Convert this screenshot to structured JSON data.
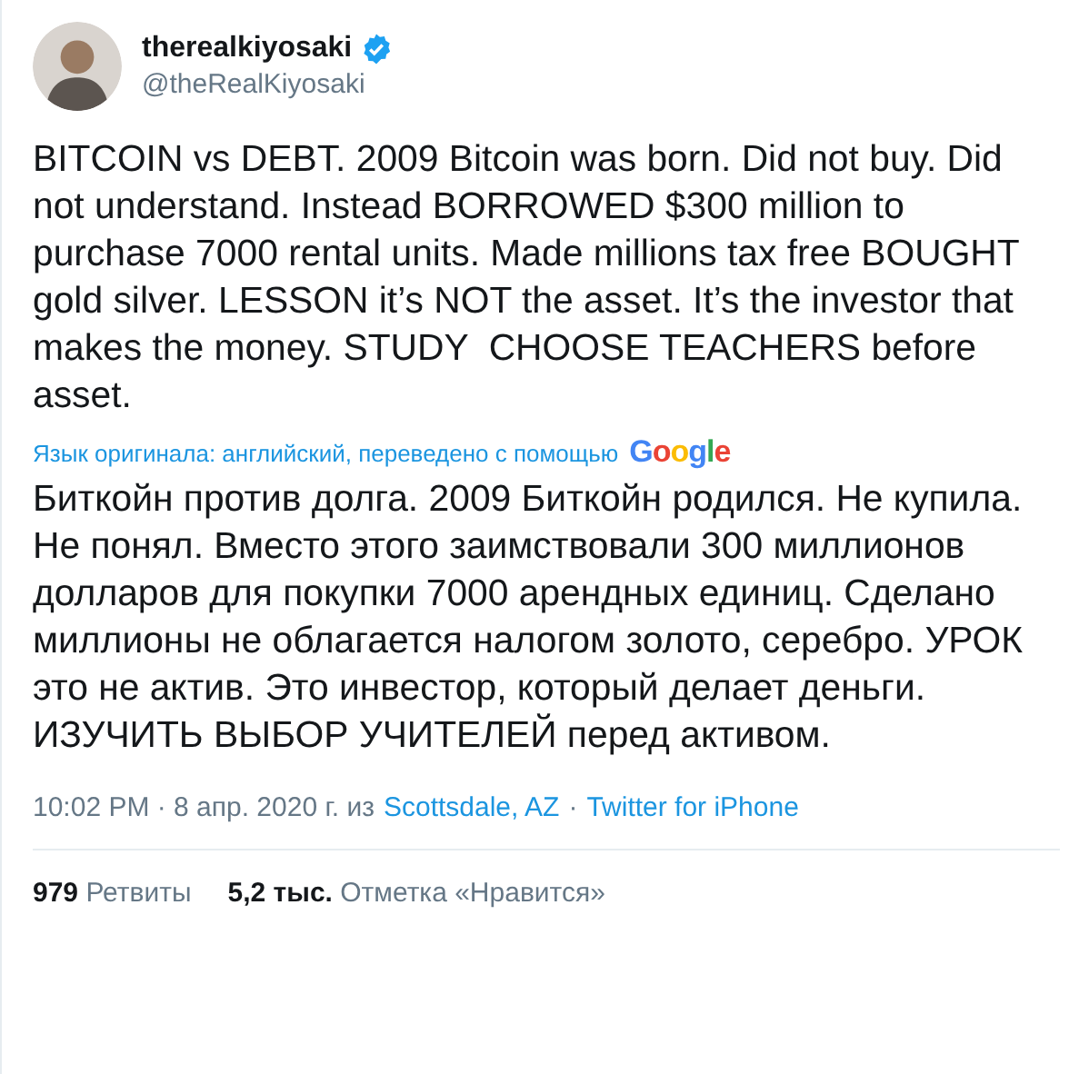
{
  "author": {
    "name": "therealkiyosaki",
    "verified": true,
    "handle": "@theRealKiyosaki"
  },
  "tweet_text": "BITCOIN vs DEBT. 2009 Bitcoin was born. Did not buy. Did not understand. Instead BORROWED $300 million to purchase 7000 rental units. Made millions tax free BOUGHT gold silver. LESSON it’s NOT the asset. It’s the investor that makes the money. STUDY  CHOOSE TEACHERS before asset.",
  "translation_note": {
    "text": "Язык оригинала: английский, переведено с помощью",
    "provider": "Google"
  },
  "translated_text": "Биткойн против долга. 2009 Биткойн родился. Не купила. Не понял. Вместо этого заимствовали 300 миллионов долларов для покупки 7000 арендных единиц. Сделано миллионы не облагается налогом золото, серебро. УРОК это не актив. Это инвестор, который делает деньги. ИЗУЧИТЬ ВЫБОР УЧИТЕЛЕЙ перед активом.",
  "meta": {
    "time": "10:02 PM · 8 апр. 2020 г. из",
    "location": "Scottsdale, AZ",
    "separator": "·",
    "source": "Twitter for iPhone"
  },
  "stats": [
    {
      "count": "979",
      "label": "Ретвиты"
    },
    {
      "count": "5,2 тыс.",
      "label": "Отметка «Нравится»"
    }
  ]
}
